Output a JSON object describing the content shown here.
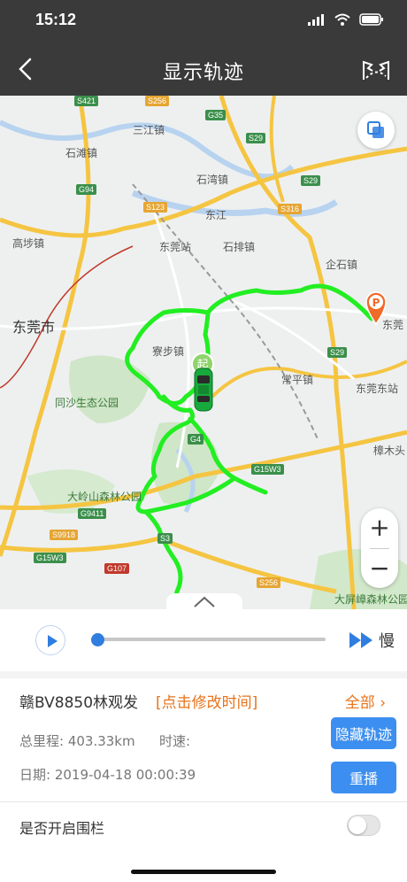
{
  "status_bar": {
    "time": "15:12"
  },
  "nav": {
    "title": "显示轨迹"
  },
  "map": {
    "labels": {
      "sanjiang": "三江镇",
      "shitan": "石滩镇",
      "shixia": "石湾镇",
      "gaobu": "高埗镇",
      "dongguan_station": "东莞站",
      "shipai": "石排镇",
      "qishi": "企石镇",
      "dongguan_city": "东莞市",
      "liaobu": "寮步镇",
      "changping": "常平镇",
      "dongguan_east_station": "东莞东站",
      "tongsha_park": "同沙生态公园",
      "daling_park": "大岭山森林公园",
      "zhangmutou": "樟木头",
      "dapingzhang_park": "大屏嶂森林公园",
      "dongguan_east_short": "东莞",
      "dongjiang": "东江"
    },
    "roads": [
      "S421",
      "S256",
      "G35",
      "S29",
      "G94",
      "S123",
      "S316",
      "S29",
      "S29",
      "G4",
      "G15W3",
      "G9411",
      "S9918",
      "G15W3",
      "G107",
      "S256",
      "S3"
    ],
    "start_marker": "起",
    "end_marker": "P"
  },
  "player": {
    "speed_label": "慢"
  },
  "info": {
    "vehicle": "赣BV8850林观发",
    "edit_time": "[点击修改时间]",
    "all_link": "全部",
    "mileage": "总里程:  403.33km",
    "speed": "时速:",
    "date": "日期:  2019-04-18 00:00:39",
    "hide_track_button": "隐藏轨迹",
    "replay_button": "重播"
  },
  "fence": {
    "label": "是否开启围栏",
    "enabled": false
  },
  "colors": {
    "track": "#22ee22",
    "accent_orange": "#e8731a",
    "button_blue": "#3c8ff0",
    "header": "#3a3a3a"
  }
}
